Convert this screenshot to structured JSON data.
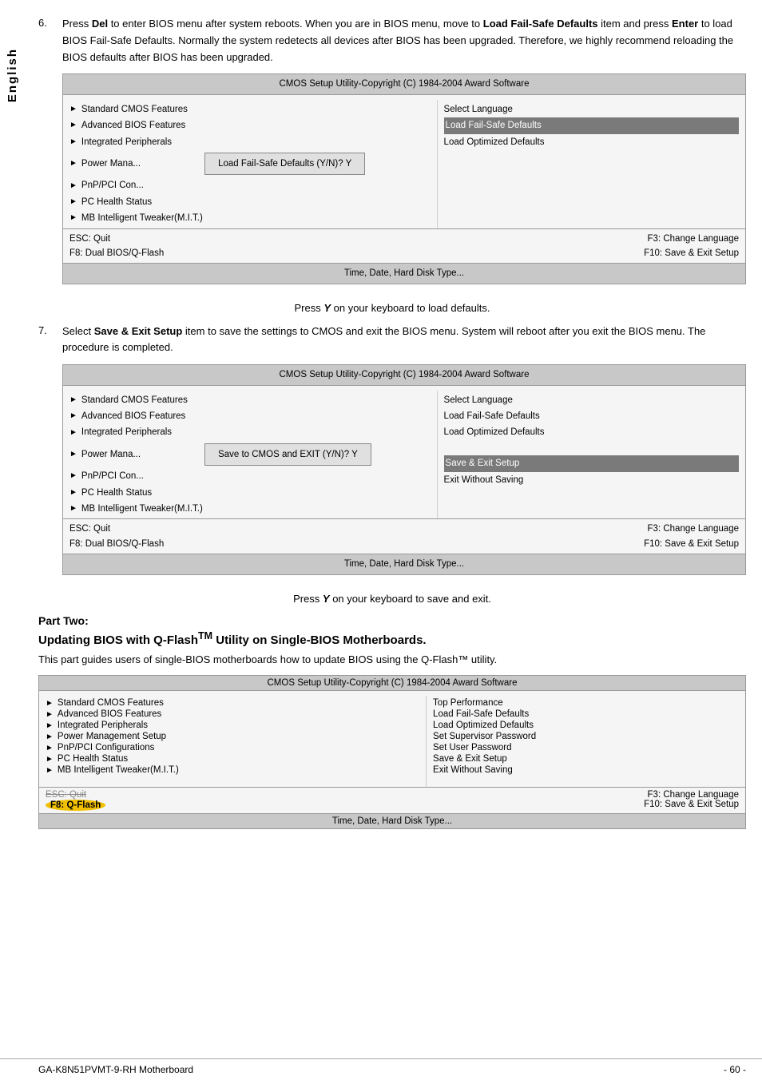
{
  "sidebar": {
    "label": "English"
  },
  "step6": {
    "number": "6.",
    "text_parts": [
      "Press ",
      "Del",
      " to enter BIOS menu after system reboots. When you are in BIOS menu, move to ",
      "Load Fail-Safe Defaults",
      " item and press ",
      "Enter",
      " to load BIOS Fail-Safe Defaults. Normally the system redetects all devices after BIOS has been upgraded. Therefore, we highly recommend reloading the BIOS defaults after BIOS has been upgraded."
    ]
  },
  "bios1": {
    "title": "CMOS Setup Utility-Copyright (C) 1984-2004 Award Software",
    "left_items": [
      "Standard CMOS Features",
      "Advanced BIOS Features",
      "Integrated Peripherals",
      "Power Mana...",
      "PnP/PCI Con...",
      "PC Health Status",
      "MB Intelligent Tweaker(M.I.T.)"
    ],
    "right_items": [
      {
        "text": "Select Language",
        "highlight": false
      },
      {
        "text": "Load Fail-Safe Defaults",
        "highlight": true
      },
      {
        "text": "Load Optimized Defaults",
        "highlight": false
      }
    ],
    "dialog": "Load Fail-Safe Defaults (Y/N)? Y",
    "footer_left1": "ESC: Quit",
    "footer_left2": "F8: Dual BIOS/Q-Flash",
    "footer_right1": "F3: Change Language",
    "footer_right2": "F10: Save & Exit Setup",
    "bottom": "Time, Date, Hard Disk Type..."
  },
  "caption1": "Press Y on your keyboard to load defaults.",
  "step7": {
    "number": "7.",
    "text_parts": [
      "Select ",
      "Save & Exit Setup",
      " item to save the settings to CMOS and exit the BIOS menu. System will reboot after you exit the BIOS menu. The procedure is completed."
    ]
  },
  "bios2": {
    "title": "CMOS Setup Utility-Copyright (C) 1984-2004 Award Software",
    "left_items": [
      "Standard CMOS Features",
      "Advanced BIOS Features",
      "Integrated Peripherals",
      "Power Mana...",
      "PnP/PCI Con...",
      "PC Health Status",
      "MB Intelligent Tweaker(M.I.T.)"
    ],
    "right_items": [
      {
        "text": "Select Language",
        "highlight": false
      },
      {
        "text": "Load Fail-Safe Defaults",
        "highlight": false
      },
      {
        "text": "Load Optimized Defaults",
        "highlight": false
      }
    ],
    "dialog": "Save to CMOS and EXIT (Y/N)? Y",
    "right_items2": [
      {
        "text": "Save & Exit Setup",
        "highlight": true
      },
      {
        "text": "Exit Without Saving",
        "highlight": false
      }
    ],
    "footer_left1": "ESC: Quit",
    "footer_left2": "F8: Dual BIOS/Q-Flash",
    "footer_right1": "F3: Change Language",
    "footer_right2": "F10: Save & Exit Setup",
    "bottom": "Time, Date, Hard Disk Type..."
  },
  "caption2": "Press Y on your keyboard to save and exit.",
  "part_two": {
    "heading": "Part Two:",
    "subheading": "Updating BIOS with Q-Flash™ Utility on Single-BIOS Motherboards.",
    "description": "This part guides users of single-BIOS motherboards how to update BIOS using the Q-Flash™ utility."
  },
  "bios3": {
    "title": "CMOS Setup Utility-Copyright (C) 1984-2004 Award Software",
    "left_items": [
      "Standard CMOS Features",
      "Advanced BIOS Features",
      "Integrated Peripherals",
      "Power Management Setup",
      "PnP/PCI Configurations",
      "PC Health Status",
      "MB Intelligent Tweaker(M.I.T.)"
    ],
    "right_items": [
      {
        "text": "Top Performance",
        "highlight": false
      },
      {
        "text": "Load Fail-Safe Defaults",
        "highlight": false
      },
      {
        "text": "Load Optimized Defaults",
        "highlight": false
      },
      {
        "text": "Set Supervisor Password",
        "highlight": false
      },
      {
        "text": "Set User Password",
        "highlight": false
      },
      {
        "text": "Save & Exit Setup",
        "highlight": false
      },
      {
        "text": "Exit Without Saving",
        "highlight": false
      }
    ],
    "footer_left1": "ESC: Quit",
    "footer_left2_normal": "F8: Q-Flash",
    "footer_right1": "F3: Change Language",
    "footer_right2": "F10: Save & Exit Setup",
    "bottom": "Time, Date, Hard Disk Type...",
    "f8_highlighted": true
  },
  "footer": {
    "left": "GA-K8N51PVMT-9-RH Motherboard",
    "right": "- 60 -"
  }
}
